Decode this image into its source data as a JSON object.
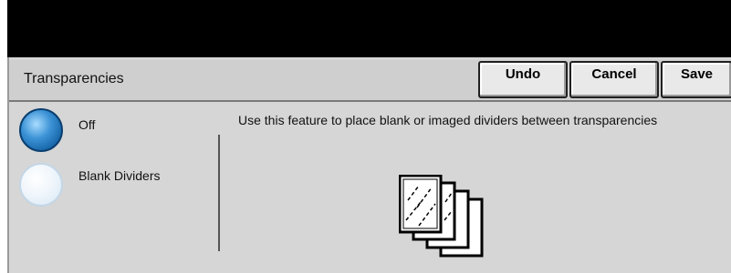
{
  "window": {
    "title": "Transparencies"
  },
  "toolbar": {
    "undo_label": "Undo",
    "cancel_label": "Cancel",
    "save_label": "Save"
  },
  "options": [
    {
      "label": "Off",
      "selected": true
    },
    {
      "label": "Blank Dividers",
      "selected": false
    }
  ],
  "description": "Use this feature to place blank or imaged dividers between transparencies",
  "illustration": {
    "icon": "transparencies-with-dividers-icon"
  },
  "colors": {
    "header_bar": "#000000",
    "panel": "#d6d6d6",
    "radio_selected": "#1f73b8",
    "radio_unselected": "#e6f0f8"
  }
}
